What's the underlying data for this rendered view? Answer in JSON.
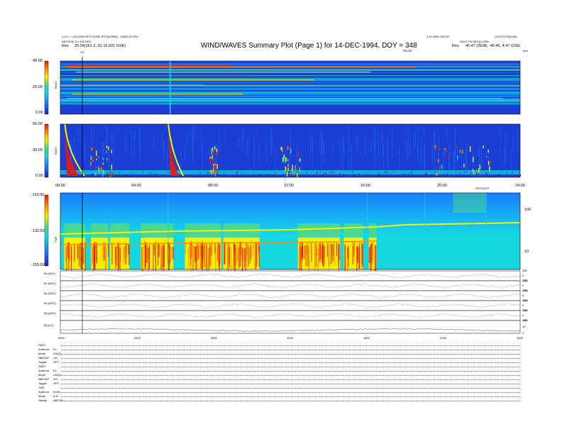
{
  "header": {
    "left_line1": "1:2.0 = 1:00 (2000:SFI7:01000 (PCS0(3998) - 41802:02 SFI)",
    "left_line2": "ARCHIVE 3 x 100 DEC",
    "left_res_label": "Res",
    "left_res_value": "25.04(161.3,-31.16,601 GSE)",
    "right_line1": "1:10 WED DEC02",
    "right_line2": "LIUSTCCR(ch)N1",
    "right_line3": "DAILY FE:DEC(I),1995",
    "right_res_label": "Res",
    "right_res_value": "45.47 (2E98, -45.45, 4:47 GSE)",
    "c4_label": "C4",
    "title": "WIND/WAVES Summary Plot (Page 1) for 14-DEC-1994, DOY = 348",
    "trunk_label": "TRUNK",
    "mhz_label": "kHz"
  },
  "colors": {
    "spectrum_bg": "#1b3fd4",
    "cold_blue": "#1a7cff",
    "cyan": "#16d7e0",
    "green": "#4cd98b",
    "yellow": "#f4f000",
    "orange": "#ff8c00",
    "red": "#e81a10"
  },
  "chart_data": [
    {
      "type": "heatmap",
      "name": "RAD2",
      "yaxis_label": "RAD2",
      "ylim": [
        0,
        40
      ],
      "yticks": [
        "40.00",
        "20.00",
        "0.00"
      ],
      "colorbar_ticks": [
        "40.00",
        "20.00",
        "0.00"
      ]
    },
    {
      "type": "heatmap",
      "name": "RAD1",
      "yaxis_label": "RAD1",
      "ylim": [
        0,
        50
      ],
      "yticks": [
        "50.00",
        "30.00",
        "0.00"
      ],
      "xlim": [
        0,
        24
      ],
      "xticks": [
        "00:00",
        "04:00",
        "08:00",
        "12:00",
        "16:00",
        "20:00",
        "24:00"
      ],
      "xaxis_right_label": "ERT/SCET"
    },
    {
      "type": "heatmap",
      "name": "TNR",
      "yaxis_label": "TNR",
      "ylim": [
        -155,
        -110
      ],
      "yticks": [
        "-110.00",
        "-132.50",
        "-155.00"
      ],
      "right_ticks": [
        "100",
        "10"
      ]
    },
    {
      "type": "line",
      "name": "magnetometer",
      "panels": [
        {
          "label": "Bt (ADC)",
          "right_ticks": [
            "250",
            "0",
            "-250"
          ]
        },
        {
          "label": "Bx (ADC)",
          "right_ticks": [
            "250",
            "0",
            "-250"
          ]
        },
        {
          "label": "By (ADC)",
          "right_ticks": [
            "250",
            "0",
            "-250"
          ]
        },
        {
          "label": "Bz (ADC)",
          "right_ticks": [
            "250",
            "0",
            "-250"
          ]
        },
        {
          "label": "|B| (ADC)",
          "right_ticks": [
            "250",
            "0",
            "-250"
          ]
        },
        {
          "label": "|B| (nT)",
          "right_ticks": [
            "100",
            "10",
            "1"
          ]
        }
      ],
      "xticks": [
        "0000",
        "0400",
        "0800",
        "1200",
        "1600",
        "2000",
        "2400"
      ]
    }
  ],
  "info_table": [
    {
      "label": "RAD1",
      "value": ""
    },
    {
      "label": "Antenna",
      "value": "Ex"
    },
    {
      "label": "Mode",
      "value": "LIN(4)"
    },
    {
      "label": "NB/GAP",
      "value": "1/6"
    },
    {
      "label": "Toggle",
      "value": "OFF"
    },
    {
      "label": "RAD2",
      "value": ""
    },
    {
      "label": "Antenna",
      "value": "Ex"
    },
    {
      "label": "Mode",
      "value": "LIN(4)"
    },
    {
      "label": "NB/GAP",
      "value": "1/6"
    },
    {
      "label": "Toggle",
      "value": "OFF"
    },
    {
      "label": "TNR",
      "value": ""
    },
    {
      "label": "Antenna",
      "value": "Ex/Ez"
    },
    {
      "label": "Mode",
      "value": "A-D"
    },
    {
      "label": "Sweep",
      "value": "ABCDE"
    }
  ]
}
